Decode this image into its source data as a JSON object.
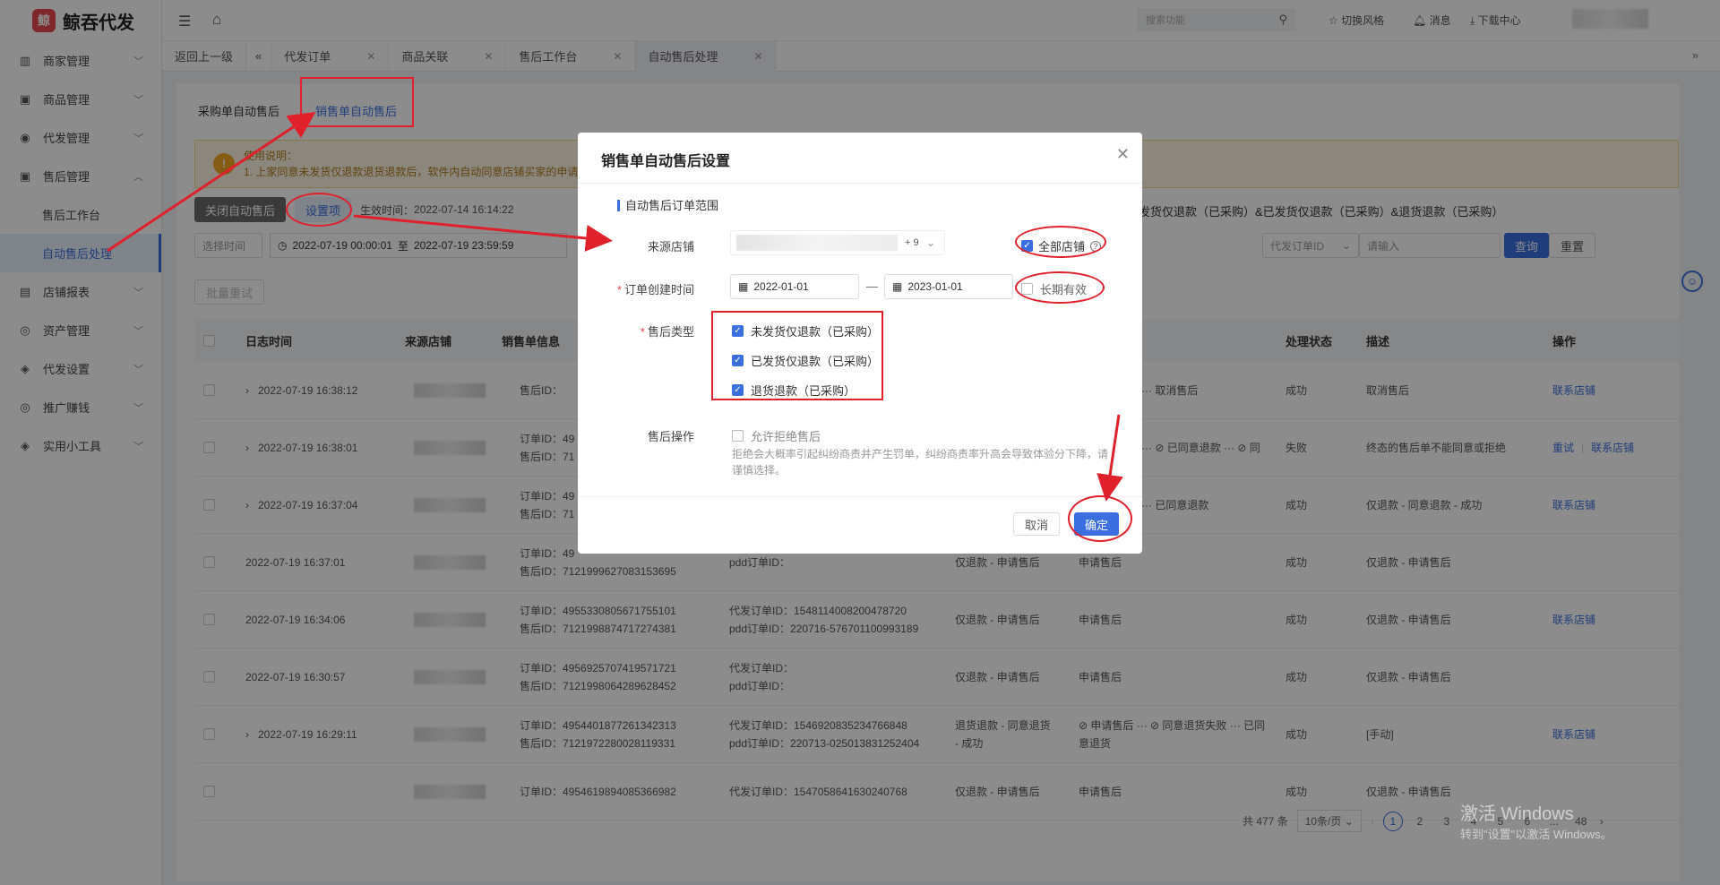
{
  "app": {
    "logo_text": "鲸吞代发",
    "logo_glyph": "鲸"
  },
  "sidebar": {
    "items": [
      {
        "label": "商家管理",
        "icon": "shop-icon"
      },
      {
        "label": "商品管理",
        "icon": "bag-icon"
      },
      {
        "label": "代发管理",
        "icon": "face-icon"
      },
      {
        "label": "售后管理",
        "icon": "bag-icon",
        "expanded": true
      },
      {
        "label": "售后工作台",
        "sub": true
      },
      {
        "label": "自动售后处理",
        "sub": true,
        "active": true
      },
      {
        "label": "店铺报表",
        "icon": "chart-icon"
      },
      {
        "label": "资产管理",
        "icon": "user-icon"
      },
      {
        "label": "代发设置",
        "icon": "settings-icon"
      },
      {
        "label": "推广赚钱",
        "icon": "user-icon"
      },
      {
        "label": "实用小工具",
        "icon": "settings-icon"
      }
    ]
  },
  "topbar": {
    "search_placeholder": "搜索功能",
    "switch_style": "切换风格",
    "messages": "消息",
    "downloads": "下载中心"
  },
  "tabs": [
    {
      "label": "返回上一级"
    },
    {
      "label": "代发订单",
      "closable": true
    },
    {
      "label": "商品关联",
      "closable": true
    },
    {
      "label": "售后工作台",
      "closable": true
    },
    {
      "label": "自动售后处理",
      "closable": true,
      "active": true
    }
  ],
  "page": {
    "subtabs": [
      "采购单自动售后",
      "销售单自动售后"
    ],
    "notice_title": "使用说明：",
    "notice_text": "1. 上家同意未发货仅退款退货退款后，软件内自动同意店铺买家的申请",
    "close_btn": "关闭自动售后",
    "settings_btn": "设置项",
    "effective_label": "生效时间：",
    "effective_time": "2022-07-14 16:14:22",
    "right_info": "发货仅退款（已采购）&已发货仅退款（已采购）&退货退款（已采购）",
    "time_select": "选择时间",
    "date_from": "2022-07-19 00:00:01",
    "date_sep": "至",
    "date_to": "2022-07-19 23:59:59",
    "order_select": "代发订单ID",
    "search_placeholder": "请输入",
    "query_btn": "查询",
    "reset_btn": "重置",
    "batch_retry": "批量重试"
  },
  "table": {
    "headers": [
      "日志时间",
      "来源店铺",
      "销售单信息",
      "处理状态",
      "描述",
      "操作"
    ],
    "rows": [
      {
        "expand": true,
        "time": "2022-07-19 16:38:12",
        "l1": "",
        "l2": "售后ID：",
        "m1": "",
        "m2": "",
        "type": "",
        "flow": "··· 取消售后",
        "status": "成功",
        "desc": "取消售后",
        "ops": [
          "联系店铺"
        ]
      },
      {
        "expand": true,
        "time": "2022-07-19 16:38:01",
        "l1": "订单ID：49",
        "l2": "售后ID：71",
        "m1": "",
        "m2": "",
        "type": "",
        "flow": "··· ⊘ 已同意退款 ··· ⊘ 同",
        "status": "失败",
        "desc": "终态的售后单不能同意或拒绝",
        "ops": [
          "重试",
          "联系店铺"
        ]
      },
      {
        "expand": true,
        "time": "2022-07-19 16:37:04",
        "l1": "订单ID：49",
        "l2": "售后ID：71",
        "m1": "",
        "m2": "",
        "type": "",
        "flow": "··· 已同意退款",
        "status": "成功",
        "desc": "仅退款 - 同意退款 - 成功",
        "ops": [
          "联系店铺"
        ]
      },
      {
        "expand": false,
        "time": "2022-07-19 16:37:01",
        "l1": "订单ID：49",
        "l2": "售后ID：7121999627083153695",
        "m1": "",
        "m2": "pdd订单ID：",
        "type": "仅退款 - 申请售后",
        "flow": "申请售后",
        "status": "成功",
        "desc": "仅退款 - 申请售后",
        "ops": []
      },
      {
        "expand": false,
        "time": "2022-07-19 16:34:06",
        "l1": "订单ID：4955330805671755101",
        "l2": "售后ID：7121998874717274381",
        "m1": "代发订单ID：1548114008200478720",
        "m2": "pdd订单ID：220716-576701100993189",
        "type": "仅退款 - 申请售后",
        "flow": "申请售后",
        "status": "成功",
        "desc": "仅退款 - 申请售后",
        "ops": [
          "联系店铺"
        ]
      },
      {
        "expand": false,
        "time": "2022-07-19 16:30:57",
        "l1": "订单ID：4956925707419571721",
        "l2": "售后ID：7121998064289628452",
        "m1": "代发订单ID：",
        "m2": "pdd订单ID：",
        "type": "仅退款 - 申请售后",
        "flow": "申请售后",
        "status": "成功",
        "desc": "仅退款 - 申请售后",
        "ops": []
      },
      {
        "expand": true,
        "time": "2022-07-19 16:29:11",
        "l1": "订单ID：4954401877261342313",
        "l2": "售后ID：7121972280028119331",
        "m1": "代发订单ID：1546920835234766848",
        "m2": "pdd订单ID：220713-025013831252404",
        "type": "退货退款 - 同意退货 - 成功",
        "flow": "⊘ 申请售后 ··· ⊘ 同意退货失败 ··· 已同意退货",
        "status": "成功",
        "desc": "[手动]",
        "ops": [
          "联系店铺"
        ]
      },
      {
        "expand": false,
        "time": "",
        "l1": "订单ID：4954619894085366982",
        "l2": "",
        "m1": "代发订单ID：1547058641630240768",
        "m2": "",
        "type": "仅退款 - 申请售后",
        "flow": "申请售后",
        "status": "成功",
        "desc": "仅退款 - 申请售后",
        "ops": []
      }
    ]
  },
  "pagination": {
    "total": "共 477 条",
    "size": "10条/页",
    "pages": [
      "1",
      "2",
      "3",
      "4",
      "5",
      "6",
      "...",
      "48"
    ],
    "current": "1"
  },
  "watermark": {
    "line1": "激活 Windows",
    "line2": "转到\"设置\"以激活 Windows。"
  },
  "dialog": {
    "title": "销售单自动售后设置",
    "section": "自动售后订单范围",
    "shop_label": "来源店铺",
    "shop_count": "+ 9",
    "all_shops": "全部店铺",
    "time_label": "订单创建时间",
    "start_date": "2022-01-01",
    "end_date": "2023-01-01",
    "long_term": "长期有效",
    "type_label": "售后类型",
    "types": [
      "未发货仅退款（已采购）",
      "已发货仅退款（已采购）",
      "退货退款（已采购）"
    ],
    "op_label": "售后操作",
    "allow_reject": "允许拒绝售后",
    "hint": "拒绝会大概率引起纠纷商责并产生罚单，纠纷商责率升高会导致体验分下降，请谨慎选择。",
    "cancel": "取消",
    "confirm": "确定"
  },
  "colors": {
    "accent": "#3b6fe0",
    "annotation": "#e0202a",
    "warning": "#f5a623"
  }
}
